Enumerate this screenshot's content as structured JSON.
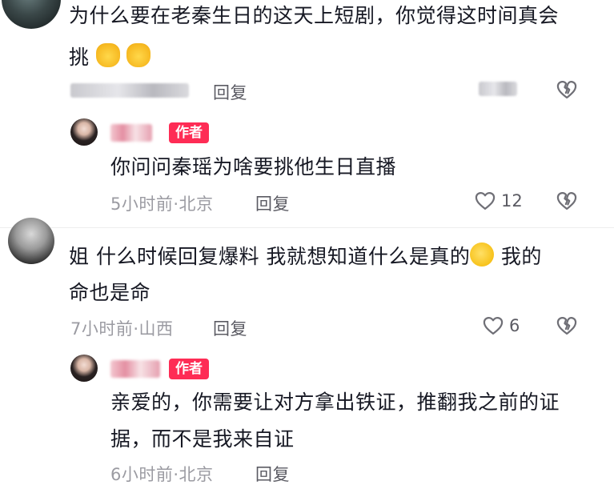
{
  "comments": [
    {
      "text_line1": "为什么要在老秦生日的这天上短剧，你觉得这时间真会",
      "text_line2": "挑",
      "reply_label": "回复"
    },
    {
      "badge": "作者",
      "text": "你问问秦瑶为啥要挑他生日直播",
      "meta": "5小时前·北京",
      "reply_label": "回复",
      "like_count": "12"
    },
    {
      "text_line1": "姐 什么时候回复爆料 我就想知道什么是真的",
      "text_line1_tail": "我的",
      "text_line2": "命也是命",
      "meta": "7小时前·山西",
      "reply_label": "回复",
      "like_count": "6"
    },
    {
      "badge": "作者",
      "text_line1": "亲爱的，你需要让对方拿出铁证，推翻我之前的证",
      "text_line2": "据，而不是我来自证",
      "meta": "6小时前·北京",
      "reply_label": "回复"
    }
  ],
  "icons": {
    "like": "heart-outline-icon",
    "dislike": "broken-heart-icon",
    "clap": "clapping-hands-emoji",
    "laugh": "rolling-laughing-emoji"
  },
  "colors": {
    "text": "#161823",
    "meta": "#9b9ba2",
    "author_badge": "#fe2c55",
    "icon_gray": "#6f6f76"
  }
}
